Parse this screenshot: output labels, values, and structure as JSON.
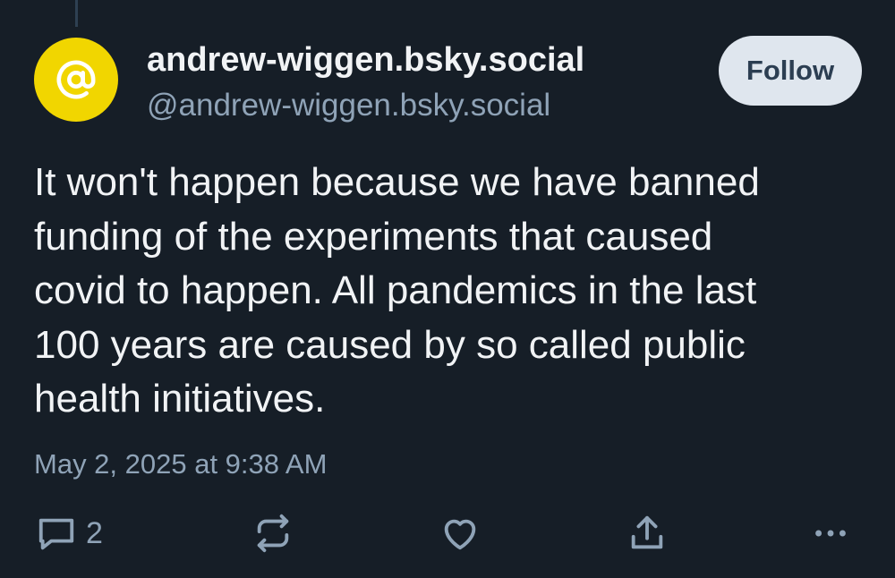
{
  "post": {
    "author": {
      "display_name": "andrew-wiggen.bsky.social",
      "handle": "@andrew-wiggen.bsky.social",
      "avatar_icon": "at-sign-icon",
      "avatar_color": "#f1d600"
    },
    "follow_label": "Follow",
    "text": "It won't happen because we have banned\nfunding of the experiments that caused\ncovid to happen.  All pandemics in the last\n100 years are caused by so called public\nhealth initiatives.",
    "timestamp": "May 2, 2025 at 9:38 AM",
    "actions": {
      "reply": {
        "icon": "reply-icon",
        "count": "2"
      },
      "repost": {
        "icon": "repost-icon"
      },
      "like": {
        "icon": "heart-icon"
      },
      "share": {
        "icon": "share-icon"
      },
      "more": {
        "icon": "more-options-icon"
      }
    }
  },
  "theme": {
    "background": "#161e27",
    "text": "#f1f3f5",
    "muted": "#8fa3b7",
    "button_bg": "#dfe6ee",
    "button_text": "#2c3e52"
  }
}
